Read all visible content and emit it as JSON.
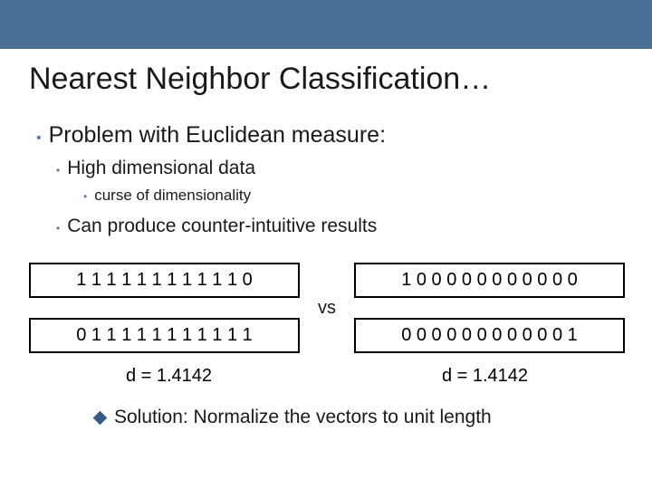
{
  "title": "Nearest Neighbor Classification…",
  "bullets": {
    "lvl1": "Problem with Euclidean measure:",
    "lvl2a": "High dimensional data",
    "lvl3a": "curse of dimensionality",
    "lvl2b": "Can produce counter-intuitive results"
  },
  "vectors": {
    "left_top": "1 1 1 1 1 1 1 1 1 1 1 0",
    "left_bot": "0 1 1 1 1 1 1 1 1 1 1 1",
    "right_top": "1 0 0 0 0 0 0 0 0 0 0 0",
    "right_bot": "0 0 0 0 0 0 0 0 0 0 0 1"
  },
  "vs": "vs",
  "dist_left": "d = 1.4142",
  "dist_right": "d = 1.4142",
  "solution": "Solution: Normalize the vectors to unit length"
}
